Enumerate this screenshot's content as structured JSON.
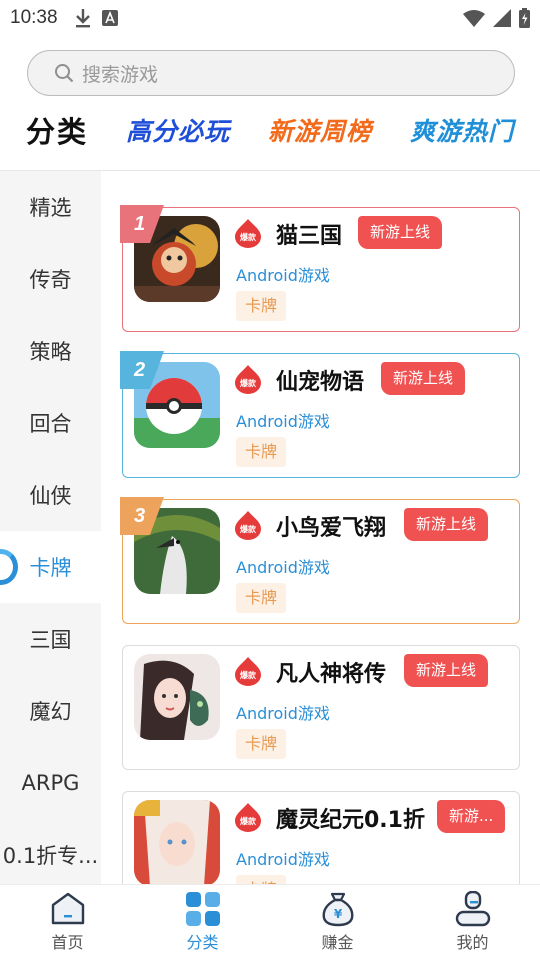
{
  "status": {
    "time": "10:38",
    "icons": [
      "download-icon",
      "a-notification-icon",
      "wifi-icon",
      "signal-icon",
      "battery-icon"
    ]
  },
  "search": {
    "placeholder": "搜索游戏"
  },
  "category_header": {
    "title": "分类",
    "tabs": [
      {
        "label": "高分必玩",
        "color": "#1f4fd8"
      },
      {
        "label": "新游周榜",
        "color": "#f26a1b"
      },
      {
        "label": "爽游热门",
        "color": "#1f8fd8"
      }
    ]
  },
  "sidebar": {
    "items": [
      {
        "label": "精选"
      },
      {
        "label": "传奇"
      },
      {
        "label": "策略"
      },
      {
        "label": "回合"
      },
      {
        "label": "仙侠"
      },
      {
        "label": "卡牌",
        "active": true
      },
      {
        "label": "三国"
      },
      {
        "label": "魔幻"
      },
      {
        "label": "ARPG"
      },
      {
        "label": "0.1折专..."
      }
    ]
  },
  "games": [
    {
      "rank": "1",
      "name": "猫三国",
      "tag": "新游上线",
      "platform": "Android游戏",
      "genre": "卡牌"
    },
    {
      "rank": "2",
      "name": "仙宠物语",
      "tag": "新游上线",
      "platform": "Android游戏",
      "genre": "卡牌"
    },
    {
      "rank": "3",
      "name": "小鸟爱飞翔",
      "tag": "新游上线",
      "platform": "Android游戏",
      "genre": "卡牌"
    },
    {
      "rank": "",
      "name": "凡人神将传",
      "tag": "新游上线",
      "platform": "Android游戏",
      "genre": "卡牌"
    },
    {
      "rank": "",
      "name": "魔灵纪元0.1折",
      "tag": "新游...",
      "platform": "Android游戏",
      "genre": "卡牌"
    }
  ],
  "hot_badge": "爆款",
  "bottom_nav": [
    {
      "label": "首页",
      "icon": "home-icon"
    },
    {
      "label": "分类",
      "icon": "category-grid-icon",
      "active": true
    },
    {
      "label": "赚金",
      "icon": "money-bag-icon"
    },
    {
      "label": "我的",
      "icon": "profile-icon"
    }
  ],
  "colors": {
    "accent": "#2b8fd8",
    "tag_red": "#f05252",
    "genre_orange": "#e89a52",
    "rank1": "#e8737a",
    "rank2": "#57b4dc",
    "rank3": "#eda35b"
  }
}
